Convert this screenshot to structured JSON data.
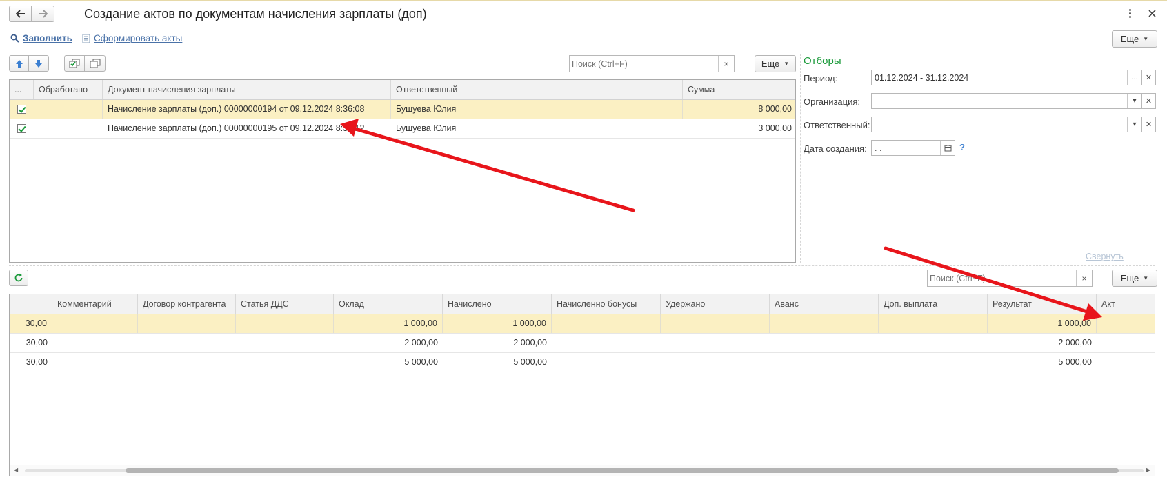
{
  "window": {
    "title": "Создание актов по документам начисления зарплаты (доп)",
    "more_menu_icon": "vertical-dots-icon",
    "close_icon": "close-icon"
  },
  "command_bar": {
    "fill_label": "Заполнить",
    "create_acts_label": "Сформировать акты",
    "more_label": "Еще"
  },
  "upper_list": {
    "search_placeholder": "Поиск (Ctrl+F)",
    "search_clear": "×",
    "more_label": "Еще",
    "columns": {
      "mark": "...",
      "processed": "Обработано",
      "document": "Документ начисления зарплаты",
      "responsible": "Ответственный",
      "sum": "Сумма"
    },
    "rows": [
      {
        "checked": true,
        "processed": "",
        "document": "Начисление зарплаты (доп.) 00000000194 от 09.12.2024 8:36:08",
        "responsible": "Бушуева Юлия",
        "sum": "8 000,00"
      },
      {
        "checked": true,
        "processed": "",
        "document": "Начисление зарплаты (доп.) 00000000195 от 09.12.2024 8:36:12",
        "responsible": "Бушуева Юлия",
        "sum": "3 000,00"
      }
    ]
  },
  "filters": {
    "title": "Отборы",
    "period_label": "Период:",
    "period_value": "01.12.2024 - 31.12.2024",
    "organization_label": "Организация:",
    "organization_value": "",
    "responsible_label": "Ответственный:",
    "responsible_value": "",
    "creation_date_label": "Дата создания:",
    "creation_date_value": " .  .",
    "help": "?",
    "collapse_label": "Свернуть"
  },
  "lower_list": {
    "search_placeholder": "Поиск (Ctrl+F)",
    "search_clear": "×",
    "more_label": "Еще",
    "columns": {
      "first": "",
      "comment": "Комментарий",
      "contract": "Договор контрагента",
      "dds": "Статья ДДС",
      "salary": "Оклад",
      "accrued": "Начислено",
      "bonus": "Начисленно бонусы",
      "withheld": "Удержано",
      "advance": "Аванс",
      "extra": "Доп. выплата",
      "result": "Результат",
      "act": "Акт"
    },
    "rows": [
      {
        "first": "30,00",
        "comment": "",
        "contract": "",
        "dds": "",
        "salary": "1 000,00",
        "accrued": "1 000,00",
        "bonus": "",
        "withheld": "",
        "advance": "",
        "extra": "",
        "result": "1 000,00",
        "act": ""
      },
      {
        "first": "30,00",
        "comment": "",
        "contract": "",
        "dds": "",
        "salary": "2 000,00",
        "accrued": "2 000,00",
        "bonus": "",
        "withheld": "",
        "advance": "",
        "extra": "",
        "result": "2 000,00",
        "act": ""
      },
      {
        "first": "30,00",
        "comment": "",
        "contract": "",
        "dds": "",
        "salary": "5 000,00",
        "accrued": "5 000,00",
        "bonus": "",
        "withheld": "",
        "advance": "",
        "extra": "",
        "result": "5 000,00",
        "act": ""
      }
    ]
  },
  "colors": {
    "accent_green": "#1a9a3a",
    "link_blue": "#4a72a8",
    "selected_row": "#fbf0c3",
    "annotation_arrow": "#e8151b"
  }
}
